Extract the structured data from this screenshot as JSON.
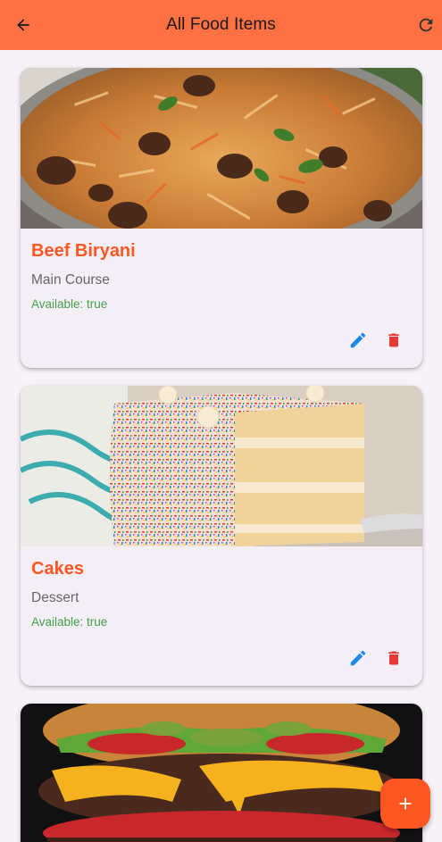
{
  "appbar": {
    "title": "All Food Items",
    "back_icon": "arrow-back-icon",
    "refresh_icon": "refresh-icon"
  },
  "colors": {
    "appbar": "#ff7043",
    "accent": "#ff5722",
    "available": "#43a047",
    "edit": "#1e88e5",
    "delete": "#e53935",
    "card_bg": "#f4eff7"
  },
  "items": [
    {
      "name": "Beef Biryani",
      "category": "Main Course",
      "availability": "Available: true",
      "image": "beef-biryani-photo"
    },
    {
      "name": "Cakes",
      "category": "Dessert",
      "availability": "Available: true",
      "image": "sprinkle-cake-photo"
    },
    {
      "image": "burger-photo"
    }
  ],
  "fab": {
    "icon": "add-icon"
  }
}
